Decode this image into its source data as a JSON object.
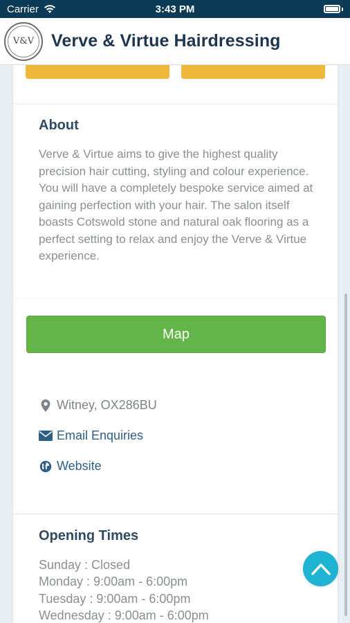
{
  "status_bar": {
    "carrier": "Carrier",
    "time": "3:43 PM",
    "wifi_icon": "wifi-icon",
    "battery_icon": "battery-icon"
  },
  "header": {
    "logo_text": "V&V",
    "title": "Verve & Virtue Hairdressing"
  },
  "about": {
    "heading": "About",
    "body": "Verve & Virtue aims to give the highest quality precision hair cutting, styling and colour experience. You will have a completely bespoke service aimed at gaining perfection with your hair. The salon itself boasts Cotswold stone and natural oak flooring as a perfect setting to relax and enjoy the Verve & Virtue experience."
  },
  "map_button": {
    "label": "Map"
  },
  "contact": {
    "location": "Witney, OX286BU",
    "email": "Email Enquiries",
    "website": "Website"
  },
  "opening_times": {
    "heading": "Opening Times",
    "rows": [
      "Sunday : Closed",
      "Monday : 9:00am - 6:00pm",
      "Tuesday : 9:00am - 6:00pm",
      "Wednesday : 9:00am - 6:00pm"
    ]
  },
  "colors": {
    "status_bar": "#0c3b57",
    "title": "#1e3550",
    "accent_orange": "#efb83b",
    "map_green": "#63b449",
    "link_blue": "#2d5f86",
    "scroll_top": "#1fb4d4"
  }
}
